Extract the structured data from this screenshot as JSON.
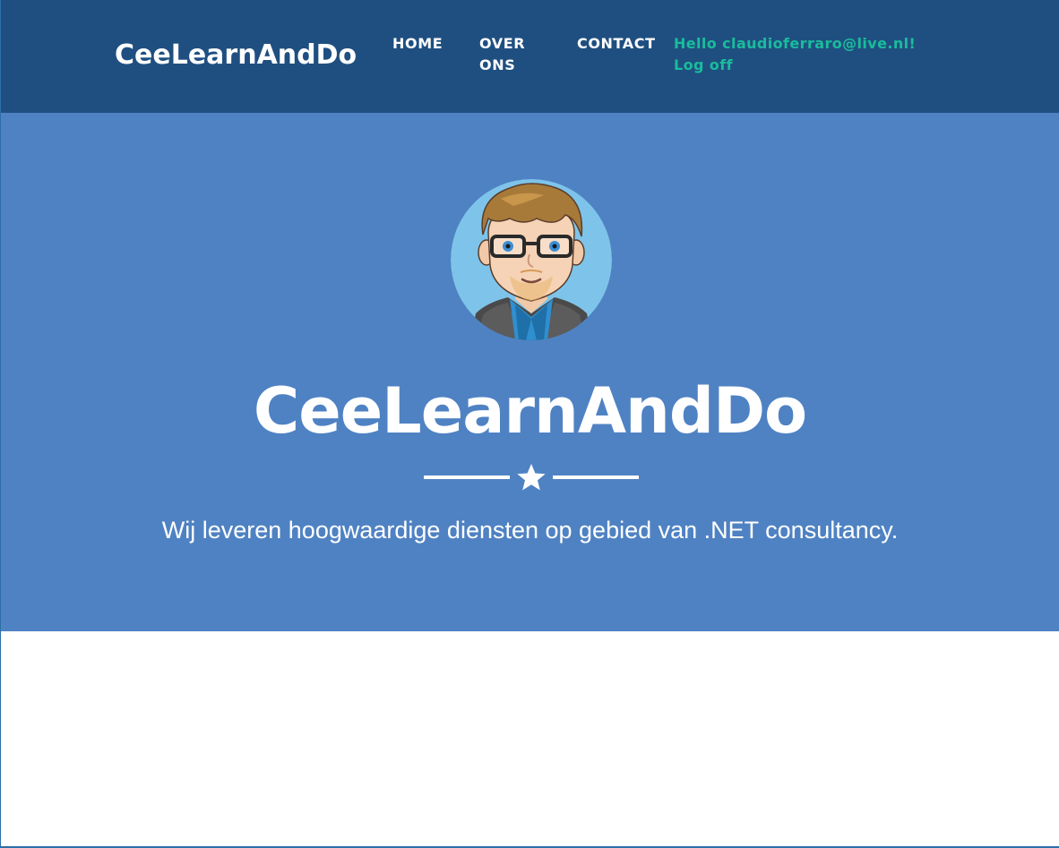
{
  "navbar": {
    "brand": "CeeLearnAndDo",
    "links": [
      {
        "label": "HOME"
      },
      {
        "label": "OVER ONS"
      },
      {
        "label": "CONTACT"
      }
    ],
    "user_greeting": "Hello claudioferraro@live.nl!",
    "logoff_label": "Log off",
    "background_color": "#1f4f80",
    "accent_color": "#1abc9c"
  },
  "hero": {
    "avatar_icon": "cartoon-avatar-icon",
    "title": "CeeLearnAndDo",
    "divider_icon": "star-icon",
    "subtitle": "Wij leveren hoogwaardige diensten op gebied van .NET consultancy.",
    "background_color": "#4f82c3"
  }
}
